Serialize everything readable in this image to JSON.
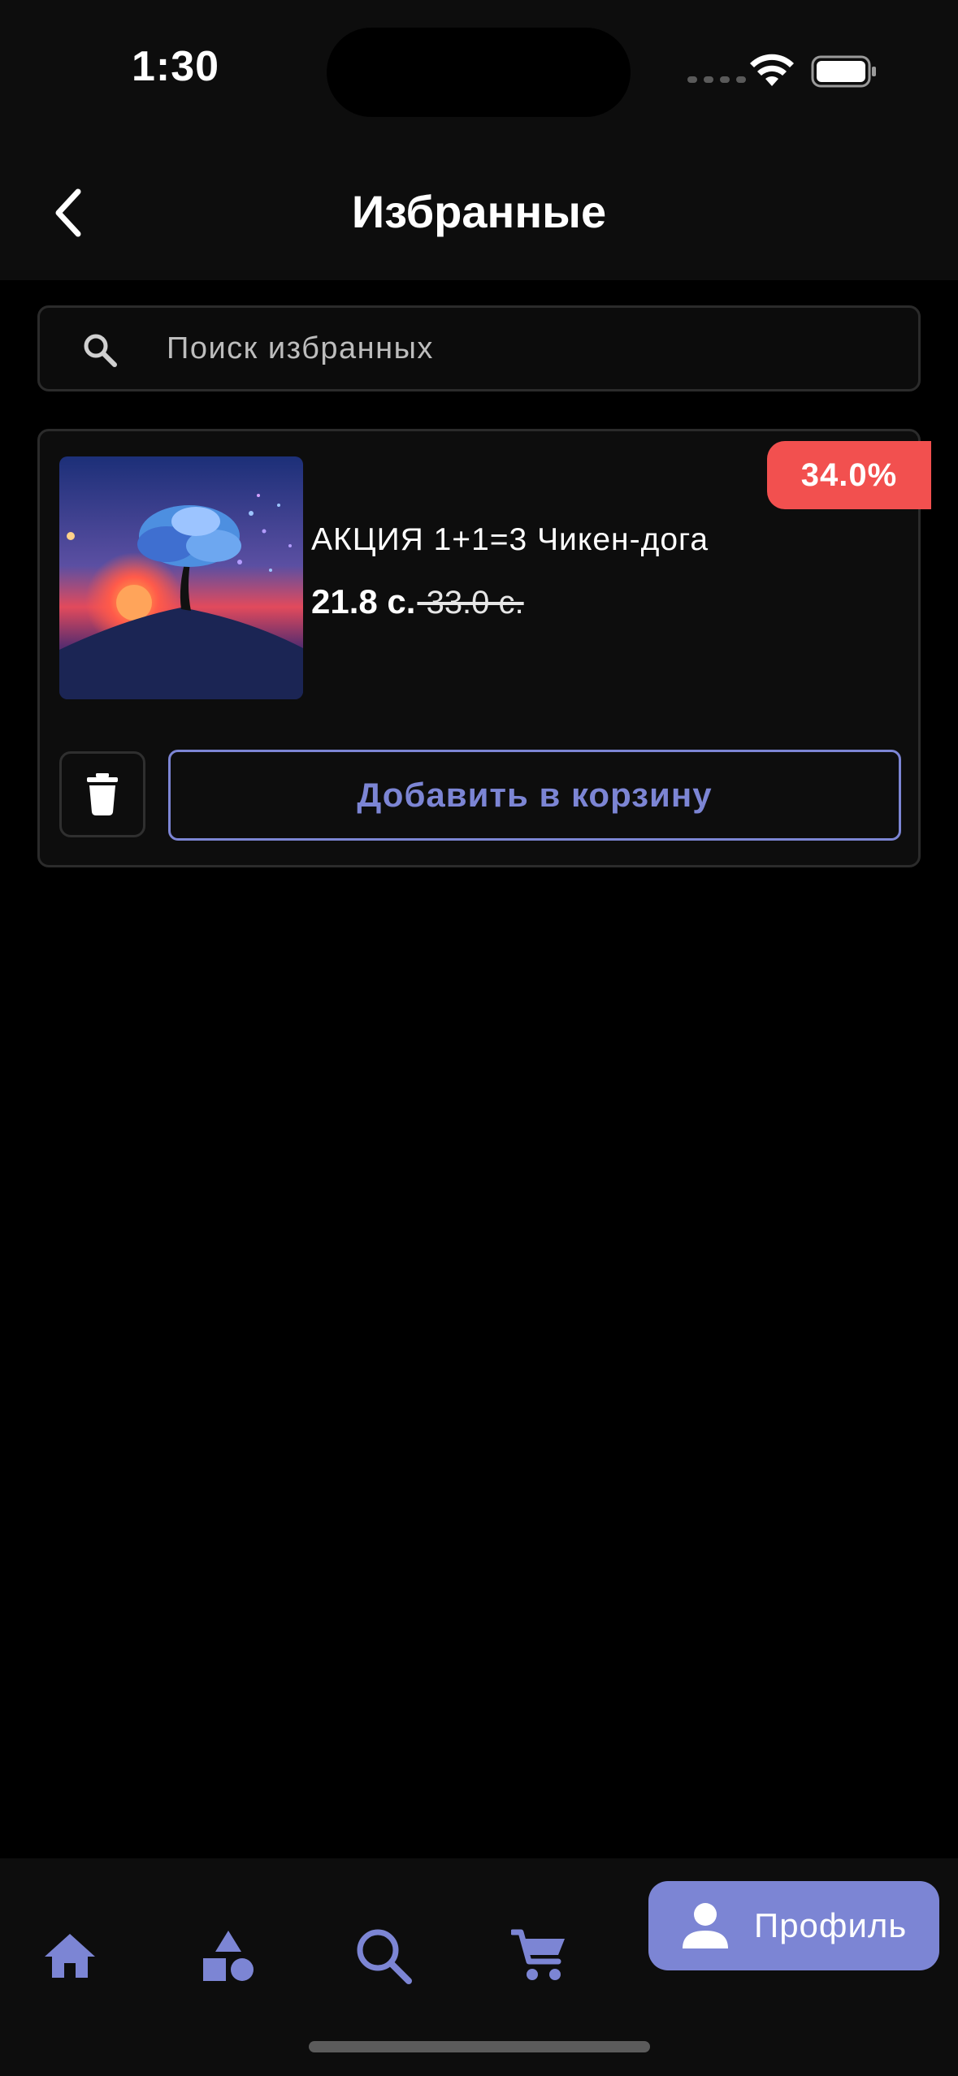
{
  "status_bar": {
    "time": "1:30"
  },
  "header": {
    "title": "Избранные"
  },
  "search": {
    "placeholder": "Поиск избранных",
    "value": ""
  },
  "favorites": [
    {
      "name": "АКЦИЯ 1+1=3 Чикен-дога",
      "price": "21.8 с.",
      "old_price": " 33.0 с.",
      "discount": "34.0%",
      "add_to_cart_label": "Добавить в корзину"
    }
  ],
  "bottom_nav": {
    "items": [
      "home-icon",
      "categories-icon",
      "search-icon",
      "cart-icon"
    ],
    "active_label": "Профиль"
  },
  "colors": {
    "accent": "#7c85d4",
    "discount_badge": "#f2504f",
    "background": "#000000",
    "surface": "#0d0d0d"
  }
}
